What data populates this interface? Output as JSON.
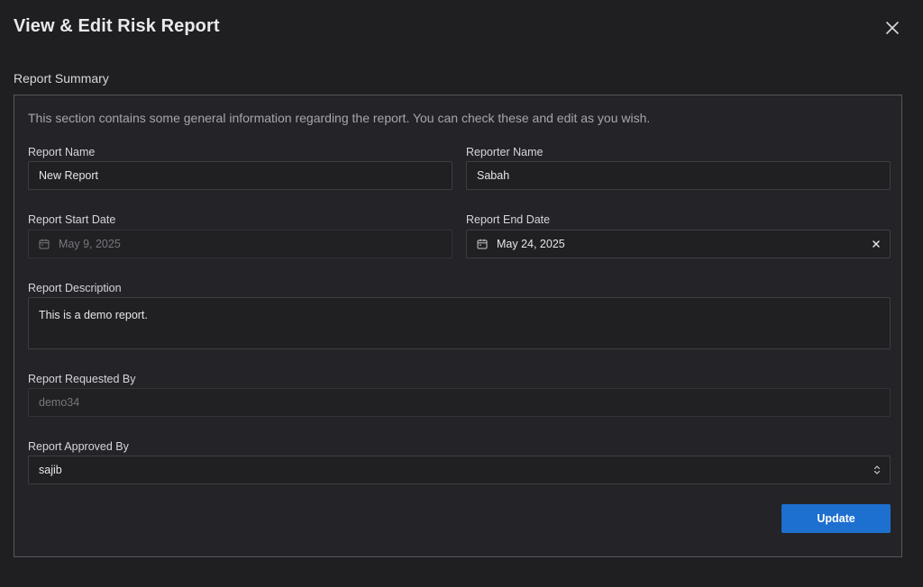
{
  "modal": {
    "title": "View & Edit Risk Report"
  },
  "section": {
    "title": "Report Summary",
    "description": "This section contains some general information regarding the report. You can check these and edit as you wish."
  },
  "fields": {
    "report_name": {
      "label": "Report Name",
      "value": "New Report"
    },
    "reporter_name": {
      "label": "Reporter Name",
      "value": "Sabah"
    },
    "start_date": {
      "label": "Report Start Date",
      "value": "May 9, 2025"
    },
    "end_date": {
      "label": "Report End Date",
      "value": "May 24, 2025"
    },
    "description": {
      "label": "Report Description",
      "value": "This is a demo report."
    },
    "requested_by": {
      "label": "Report Requested By",
      "value": "demo34"
    },
    "approved_by": {
      "label": "Report Approved By",
      "value": "sajib"
    }
  },
  "actions": {
    "update_label": "Update"
  },
  "colors": {
    "accent": "#1d6fd0",
    "background": "#1f1f22",
    "panel": "#242428"
  },
  "icons": {
    "close": "close-icon",
    "calendar": "calendar-icon",
    "clear": "clear-icon",
    "select": "chevron-up-down-icon"
  }
}
